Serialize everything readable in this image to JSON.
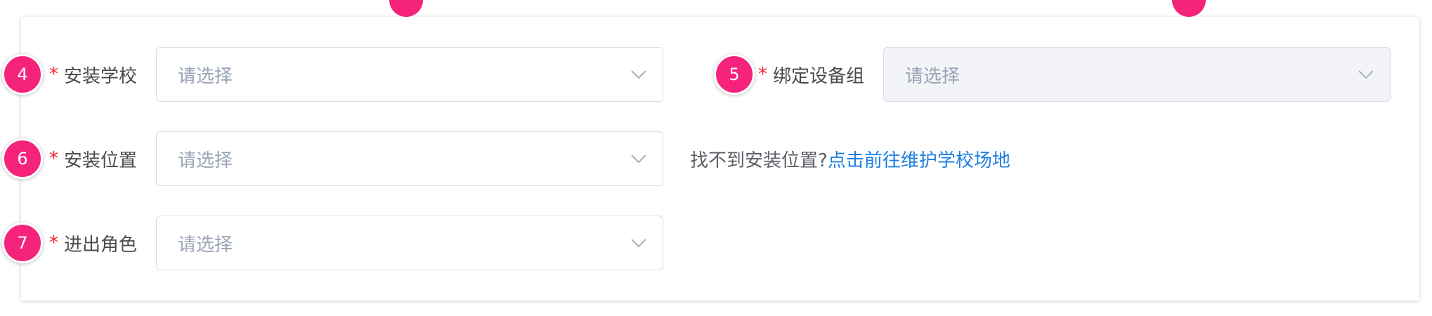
{
  "colors": {
    "badge": "#f5237c",
    "required": "#f5222d",
    "link": "#1e7fe0",
    "placeholder": "#9aa4b6"
  },
  "badges": {
    "b4": "4",
    "b5": "5",
    "b6": "6",
    "b7": "7"
  },
  "form": {
    "required_mark": "*",
    "install_school": {
      "label": "安装学校",
      "placeholder": "请选择"
    },
    "device_group": {
      "label": "绑定设备组",
      "placeholder": "请选择",
      "disabled": true
    },
    "install_location": {
      "label": "安装位置",
      "placeholder": "请选择",
      "hint_text": "找不到安装位置?",
      "hint_link": "点击前往维护学校场地"
    },
    "access_role": {
      "label": "进出角色",
      "placeholder": "请选择"
    }
  }
}
